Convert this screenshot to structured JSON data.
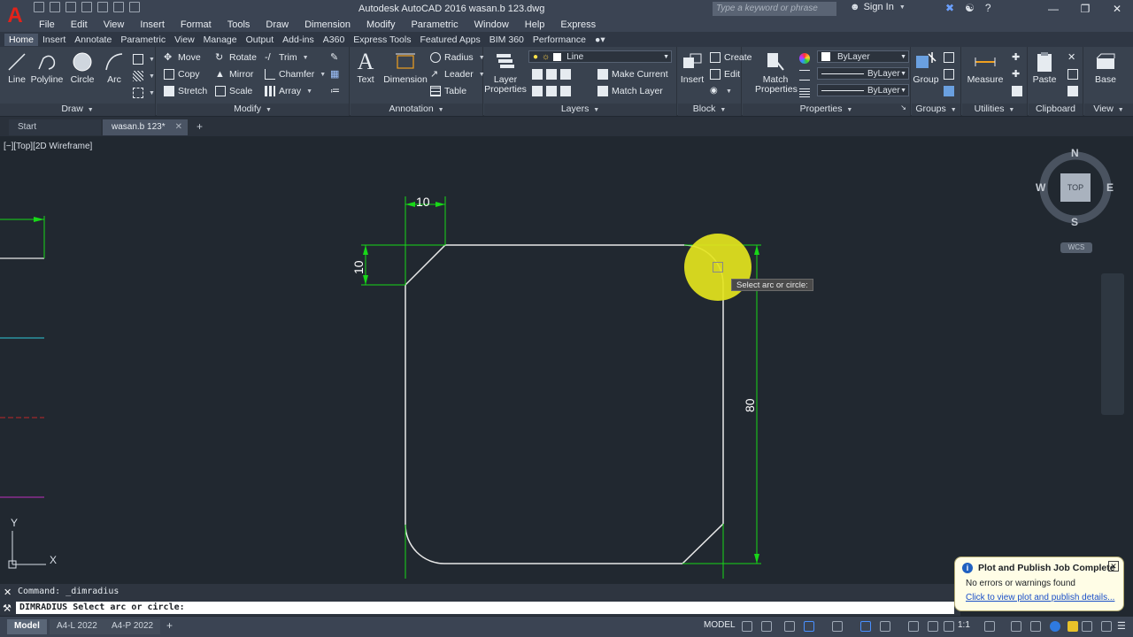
{
  "app": {
    "title": "Autodesk AutoCAD 2016    wasan.b 123.dwg",
    "logo": "A",
    "search_placeholder": "Type a keyword or phrase",
    "signin_label": "Sign In"
  },
  "menubar": [
    "File",
    "Edit",
    "View",
    "Insert",
    "Format",
    "Tools",
    "Draw",
    "Dimension",
    "Modify",
    "Parametric",
    "Window",
    "Help",
    "Express"
  ],
  "ribbon_tabs": [
    "Home",
    "Insert",
    "Annotate",
    "Parametric",
    "View",
    "Manage",
    "Output",
    "Add-ins",
    "A360",
    "Express Tools",
    "Featured Apps",
    "BIM 360",
    "Performance"
  ],
  "ribbon": {
    "draw": {
      "title": "Draw",
      "line": "Line",
      "polyline": "Polyline",
      "circle": "Circle",
      "arc": "Arc"
    },
    "modify": {
      "title": "Modify",
      "move": "Move",
      "rotate": "Rotate",
      "trim": "Trim",
      "copy": "Copy",
      "mirror": "Mirror",
      "chamfer": "Chamfer",
      "stretch": "Stretch",
      "scale": "Scale",
      "array": "Array"
    },
    "annotation": {
      "title": "Annotation",
      "text": "Text",
      "dimension": "Dimension",
      "radius": "Radius",
      "leader": "Leader",
      "table": "Table"
    },
    "layers": {
      "title": "Layers",
      "layer_properties": "Layer Properties",
      "layer_combo": "Line",
      "make_current": "Make Current",
      "match_layer": "Match Layer"
    },
    "block": {
      "title": "Block",
      "insert": "Insert",
      "create": "Create",
      "edit": "Edit"
    },
    "properties": {
      "title": "Properties",
      "match_properties": "Match Properties",
      "color": "ByLayer",
      "linetype": "ByLayer",
      "lineweight": "ByLayer"
    },
    "groups": {
      "title": "Groups",
      "group": "Group"
    },
    "utilities": {
      "title": "Utilities",
      "measure": "Measure"
    },
    "clipboard": {
      "title": "Clipboard",
      "paste": "Paste"
    },
    "view": {
      "title": "View",
      "base": "Base"
    }
  },
  "file_tabs": {
    "start": "Start",
    "current": "wasan.b 123*"
  },
  "viewport": {
    "label": "[−][Top][2D Wireframe]",
    "compass": {
      "n": "N",
      "s": "S",
      "e": "E",
      "w": "W",
      "top": "TOP",
      "wcs": "WCS"
    },
    "ucs": {
      "x": "X",
      "y": "Y"
    }
  },
  "drawing": {
    "dim_top": "10",
    "dim_left": "10",
    "dim_right": "80",
    "tooltip": "Select arc or circle:"
  },
  "command": {
    "history": "Command: _dimradius",
    "prompt": "DIMRADIUS Select arc or circle:"
  },
  "notification": {
    "title": "Plot and Publish Job Complete",
    "message": "No errors or warnings found",
    "link": "Click to view plot and publish details..."
  },
  "status": {
    "layouts": [
      "Model",
      "A4-L 2022",
      "A4-P 2022"
    ],
    "model": "MODEL",
    "scale": "1:1"
  },
  "colors": {
    "accent_red": "#e2231a",
    "dimension_green": "#18d818",
    "geometry_white": "#e8e8e8",
    "highlight_yellow": "#e4e41e"
  }
}
